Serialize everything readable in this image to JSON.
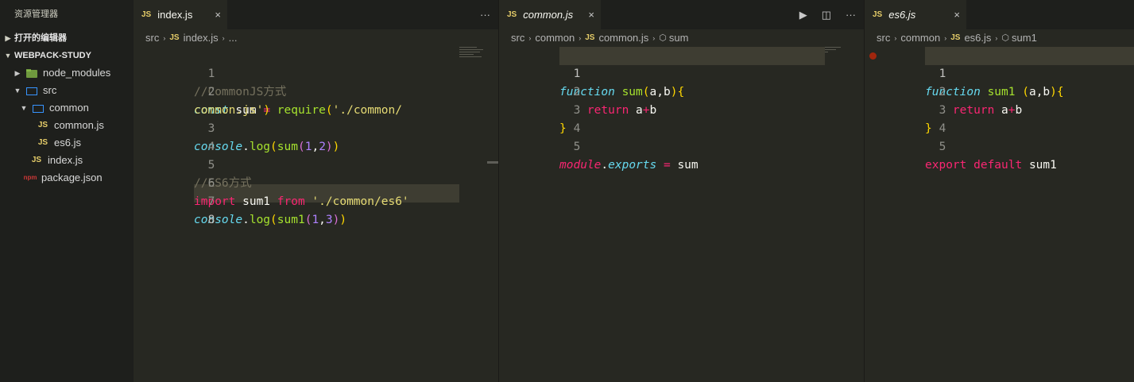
{
  "sidebar": {
    "title": "资源管理器",
    "open_editors": "打开的编辑器",
    "project": "WEBPACK-STUDY",
    "tree": [
      {
        "label": "node_modules"
      },
      {
        "label": "src"
      },
      {
        "label": "common"
      },
      {
        "label": "common.js"
      },
      {
        "label": "es6.js"
      },
      {
        "label": "index.js"
      },
      {
        "label": "package.json"
      }
    ],
    "js_badge": "JS",
    "npm_badge": "npm"
  },
  "editors": {
    "left": {
      "tab": "index.js",
      "badge": "JS",
      "close": "×",
      "more": "···",
      "breadcrumb": [
        "src",
        "index.js",
        "..."
      ],
      "lines": [
        "1",
        "2",
        "3",
        "4",
        "5",
        "6",
        "7",
        "8"
      ]
    },
    "middle": {
      "tab": "common.js",
      "badge": "JS",
      "close": "×",
      "run": "▶",
      "split": "◫",
      "more": "···",
      "breadcrumb": [
        "src",
        "common",
        "common.js",
        "sum"
      ],
      "lines": [
        "1",
        "2",
        "3",
        "4",
        "5"
      ]
    },
    "right": {
      "tab": "es6.js",
      "badge": "JS",
      "close": "×",
      "breadcrumb": [
        "src",
        "common",
        "es6.js",
        "sum1"
      ],
      "lines": [
        "1",
        "2",
        "3",
        "4",
        "5"
      ]
    }
  },
  "code": {
    "index": {
      "l1": "//CommonJS方式",
      "l2a_kw": "const",
      "l2a_var": " sum ",
      "l2a_eq": "=",
      "l2a_fn": " require",
      "l2a_p": "(",
      "l2a_str": "'./common/",
      "l2b_str": "common.js'",
      "l2b_p": ")",
      "l3_obj": "console",
      "l3_dot": ".",
      "l3_fn": "log",
      "l3_p1": "(",
      "l3_fn2": "sum",
      "l3_p2": "(",
      "l3_n1": "1",
      "l3_c": ",",
      "l3_n2": "2",
      "l3_p3": ")",
      "l3_p4": ")",
      "l5": "//ES6方式",
      "l6_kw": "import",
      "l6_var": " sum1 ",
      "l6_from": "from",
      "l6_str": " './common/es6'",
      "l7_obj": "console",
      "l7_dot": ".",
      "l7_fn": "log",
      "l7_p1": "(",
      "l7_fn2": "sum1",
      "l7_p2": "(",
      "l7_n1": "1",
      "l7_c": ",",
      "l7_n2": "3",
      "l7_p3": ")",
      "l7_p4": ")"
    },
    "common": {
      "l1_kw": "function",
      "l1_fn": " sum",
      "l1_p": "(",
      "l1_args": "a,b",
      "l1_p2": ")",
      "l1_b": "{",
      "l2_kw": "    return",
      "l2_a": " a",
      "l2_op": "+",
      "l2_b": "b",
      "l3": "}",
      "l5_obj": "module",
      "l5_dot": ".",
      "l5_prop": "exports",
      "l5_eq": " = ",
      "l5_var": "sum"
    },
    "es6": {
      "l1_kw": "function",
      "l1_fn": " sum1",
      "l1_p": " (",
      "l1_args": "a,b",
      "l1_p2": ")",
      "l1_b": "{",
      "l2_kw": "    return",
      "l2_a": " a",
      "l2_op": "+",
      "l2_b": "b",
      "l3": "}",
      "l5_kw": "export default",
      "l5_var": " sum1"
    }
  }
}
